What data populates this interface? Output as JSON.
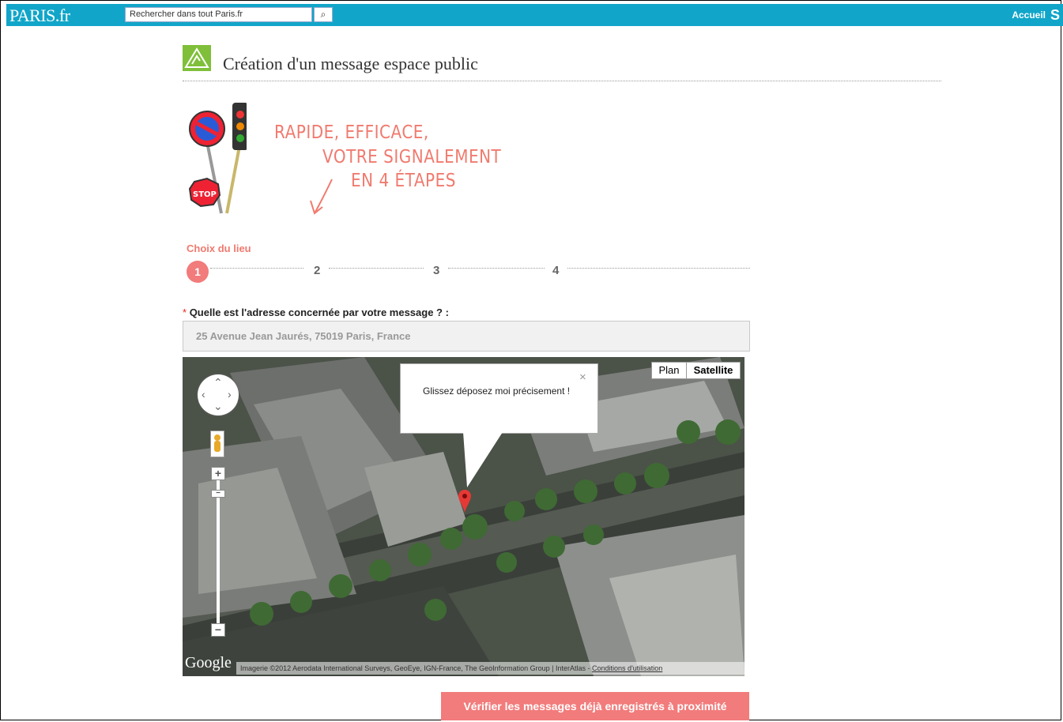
{
  "header": {
    "logo": "PARIS.fr",
    "search_placeholder": "Rechercher dans tout Paris.fr",
    "home_link": "Accueil"
  },
  "page": {
    "title": "Création d'un message espace public"
  },
  "tagline": {
    "line1": "RAPIDE, EFFICACE,",
    "line2": "VOTRE SIGNALEMENT",
    "line3": "EN 4 ÉTAPES"
  },
  "steps": {
    "current_label": "Choix du lieu",
    "items": [
      "1",
      "2",
      "3",
      "4"
    ],
    "current": 1
  },
  "form": {
    "required_mark": "*",
    "address_question": "Quelle est l'adresse concernée par votre message ? :",
    "address_value": "25 Avenue Jean Jaurés, 75019 Paris, France"
  },
  "map": {
    "type_plan": "Plan",
    "type_satellite": "Satellite",
    "selected_type": "Satellite",
    "bubble_text": "Glissez déposez moi précisement !",
    "bubble_close": "×",
    "google_logo": "Google",
    "attribution": "Imagerie ©2012 Aerodata International Surveys, GeoEye, IGN-France, The GeoInformation Group | InterAtlas - ",
    "terms_link": "Conditions d'utilisation",
    "zoom_in": "+",
    "zoom_out": "−"
  },
  "actions": {
    "check_nearby": "Vérifier les messages déjà enregistrés à proximité"
  },
  "colors": {
    "topbar": "#11a6c9",
    "accent": "#f27b7b",
    "tagline": "#f07a6e",
    "icon_green": "#7fbf3a"
  }
}
